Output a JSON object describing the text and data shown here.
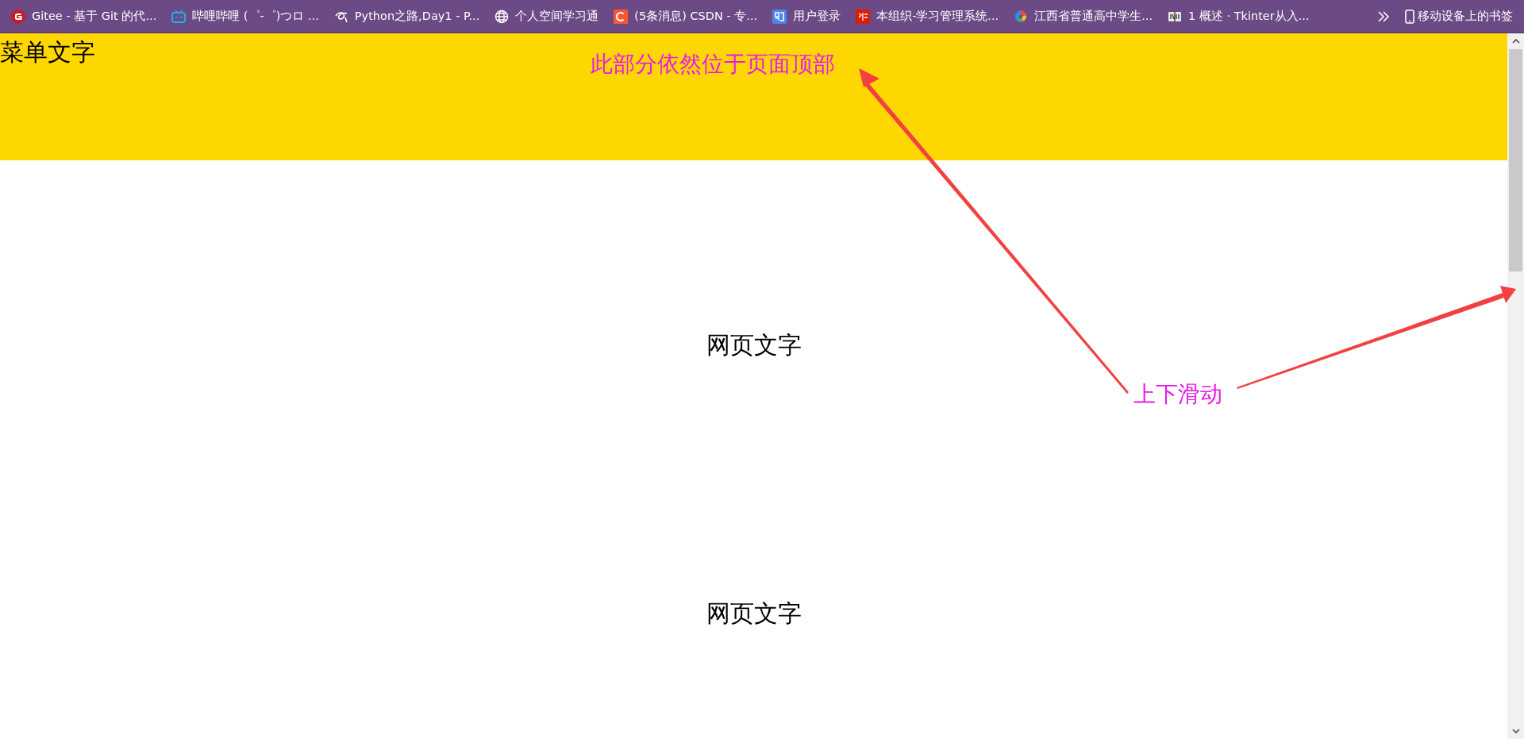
{
  "bookmarks_bar": {
    "items": [
      {
        "label": "Gitee - 基于 Git 的代..."
      },
      {
        "label": "哔哩哔哩 (゜-゜)つロ ..."
      },
      {
        "label": "Python之路,Day1 - P..."
      },
      {
        "label": "个人空间学习通"
      },
      {
        "label": "(5条消息) CSDN - 专..."
      },
      {
        "label": "用户登录"
      },
      {
        "label": "本组织-学习管理系统..."
      },
      {
        "label": "江西省普通高中学生..."
      },
      {
        "label": "1 概述 · Tkinter从入..."
      }
    ],
    "mobile_bookmarks": "移动设备上的书签"
  },
  "header": {
    "menu_text": "菜单文字"
  },
  "body": {
    "texts": [
      "网页文字",
      "网页文字"
    ]
  },
  "annotations": {
    "top_note": "此部分依然位于页面顶部",
    "scroll_note": "上下滑动"
  }
}
